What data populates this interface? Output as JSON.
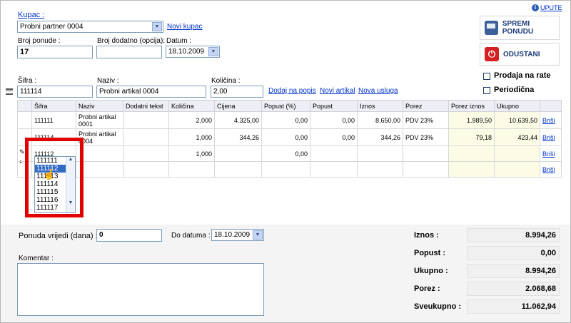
{
  "header": {
    "upute": "UPUTE",
    "kupac_label": "Kupac :",
    "kupac_value": "Probni partner 0004",
    "novi_kupac": "Novi kupac",
    "broj_ponude_label": "Broj ponude :",
    "broj_ponude_value": "17",
    "broj_dodatno_label": "Broj dodatno (opcija):",
    "broj_dodatno_value": "",
    "datum_label": "Datum :",
    "datum_value": "18.10.2009"
  },
  "actions": {
    "save_label": "SPREMI PONUDU",
    "cancel_label": "ODUSTANI"
  },
  "options": {
    "prodaja_na_rate": "Prodaja na rate",
    "periodicna": "Periodična"
  },
  "entry": {
    "sifra_label": "Šifra :",
    "sifra_value": "111114",
    "naziv_label": "Naziv :",
    "naziv_value": "Probni artikal 0004",
    "kolicina_label": "Količina :",
    "kolicina_value": "2,00",
    "dodaj_na_popis": "Dodaj na popis",
    "novi_artikal": "Novi artikal",
    "nova_usluga": "Nova usluga"
  },
  "table": {
    "columns": [
      "Šifra",
      "Naziv",
      "Dodatni tekst",
      "Količina",
      "Cijena",
      "Popust (%)",
      "Popust",
      "Iznos",
      "Porez",
      "Porez iznos",
      "Ukupno",
      ""
    ],
    "rows": [
      {
        "sifra": "111111",
        "naziv": "Probni artikal 0001",
        "dodatni": "",
        "kolicina": "2,000",
        "cijena": "4.325,00",
        "popust_pct": "0,00",
        "popust": "0,00",
        "iznos": "8.650,00",
        "porez": "PDV 23%",
        "porez_iznos": "1.989,50",
        "ukupno": "10.639,50",
        "action": "Briši"
      },
      {
        "sifra": "111114",
        "naziv": "Probni artikal 0004",
        "dodatni": "",
        "kolicina": "1,000",
        "cijena": "344,26",
        "popust_pct": "0,00",
        "popust": "0,00",
        "iznos": "344,26",
        "porez": "PDV 23%",
        "porez_iznos": "79,18",
        "ukupno": "423,44",
        "action": "Briši"
      },
      {
        "sifra": "111112",
        "naziv": "",
        "dodatni": "",
        "kolicina": "1,000",
        "cijena": "",
        "popust_pct": "0,00",
        "popust": "",
        "iznos": "",
        "porez": "",
        "porez_iznos": "",
        "ukupno": "",
        "action": "Briši"
      },
      {
        "sifra": "",
        "naziv": "",
        "dodatni": "",
        "kolicina": "",
        "cijena": "",
        "popust_pct": "",
        "popust": "",
        "iznos": "",
        "porez": "",
        "porez_iznos": "",
        "ukupno": "",
        "action": "Briši"
      }
    ]
  },
  "dropdown": {
    "options": [
      "111111",
      "111112",
      "111113",
      "111114",
      "111115",
      "111116",
      "111117"
    ],
    "selected_index": 1
  },
  "footer": {
    "ponuda_vrijedi_label": "Ponuda vrijedi (dana) :",
    "ponuda_vrijedi_value": "0",
    "do_datuma_label": "Do datuma :",
    "do_datuma_value": "18.10.2009",
    "komentar_label": "Komentar :",
    "komentar_value": ""
  },
  "summary": {
    "iznos_label": "Iznos :",
    "iznos_value": "8.994,26",
    "popust_label": "Popust :",
    "popust_value": "0,00",
    "ukupno_label": "Ukupno :",
    "ukupno_value": "8.994,26",
    "porez_label": "Porez :",
    "porez_value": "2.068,68",
    "sveukupno_label": "Sveukupno :",
    "sveukupno_value": "11.062,94"
  },
  "colors": {
    "link": "#0033cc",
    "highlight": "#e00000",
    "selection": "#316ac5",
    "totals_bg": "#fcfce6"
  }
}
